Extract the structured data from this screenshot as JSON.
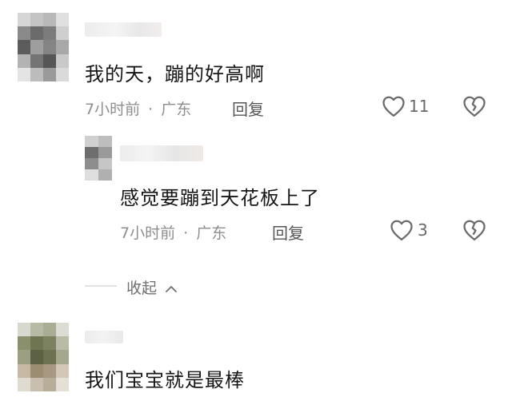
{
  "comments": [
    {
      "text": "我的天，蹦的好高啊",
      "time": "7小时前",
      "separator": "·",
      "location": "广东",
      "reply_label": "回复",
      "like_count": "11",
      "like_icon": "heart-outline-icon",
      "dislike_icon": "broken-heart-icon",
      "replies": [
        {
          "text": "感觉要蹦到天花板上了",
          "time": "7小时前",
          "separator": "·",
          "location": "广东",
          "reply_label": "回复",
          "like_count": "3",
          "like_icon": "heart-outline-icon",
          "dislike_icon": "broken-heart-icon"
        }
      ],
      "collapse_label": "收起",
      "collapse_icon": "chevron-up-icon"
    },
    {
      "text": "我们宝宝就是最棒"
    }
  ],
  "colors": {
    "text": "#161616",
    "meta": "#8e8e8e",
    "icon": "#6a6a6a"
  }
}
